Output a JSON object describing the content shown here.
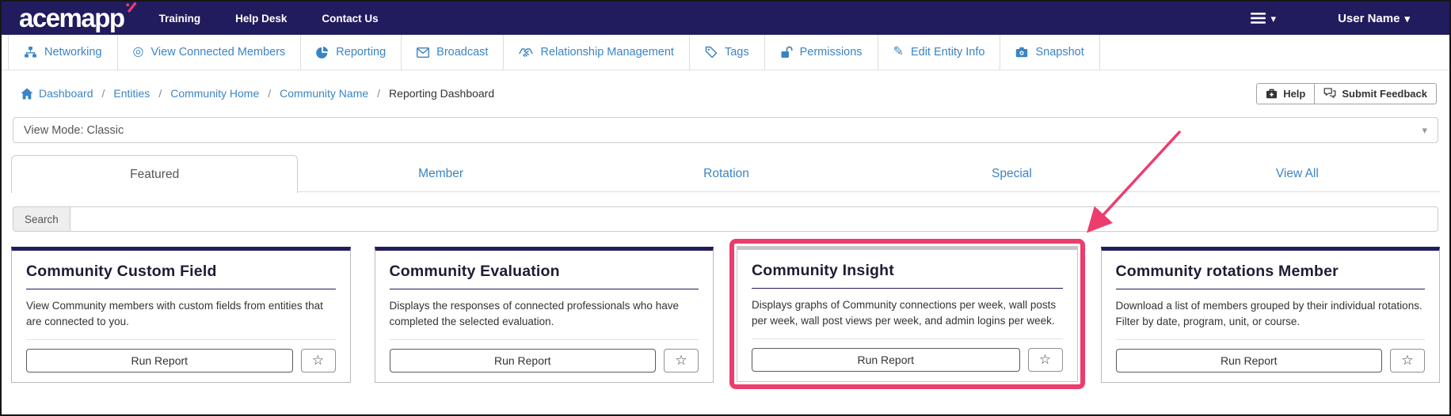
{
  "header": {
    "logo": "acemapp",
    "nav": [
      {
        "label": "Training"
      },
      {
        "label": "Help Desk"
      },
      {
        "label": "Contact Us"
      }
    ],
    "user_name": "User Name"
  },
  "toolbar": {
    "items": [
      {
        "label": "Networking",
        "icon": "sitemap"
      },
      {
        "label": "View Connected Members",
        "icon": "eye-target"
      },
      {
        "label": "Reporting",
        "icon": "pie-chart"
      },
      {
        "label": "Broadcast",
        "icon": "envelope"
      },
      {
        "label": "Relationship Management",
        "icon": "handshake"
      },
      {
        "label": "Tags",
        "icon": "tag"
      },
      {
        "label": "Permissions",
        "icon": "unlock"
      },
      {
        "label": "Edit Entity Info",
        "icon": "pencil"
      },
      {
        "label": "Snapshot",
        "icon": "camera"
      }
    ]
  },
  "breadcrumb": {
    "separator": "/",
    "items": [
      {
        "label": "Dashboard"
      },
      {
        "label": "Entities"
      },
      {
        "label": "Community Home"
      },
      {
        "label": "Community Name"
      },
      {
        "label": "Reporting Dashboard"
      }
    ]
  },
  "actions": {
    "help": "Help",
    "submit_feedback": "Submit Feedback"
  },
  "view_mode": {
    "value": "View Mode: Classic"
  },
  "tabs": [
    {
      "label": "Featured",
      "active": true
    },
    {
      "label": "Member",
      "active": false
    },
    {
      "label": "Rotation",
      "active": false
    },
    {
      "label": "Special",
      "active": false
    },
    {
      "label": "View All",
      "active": false
    }
  ],
  "search": {
    "label": "Search",
    "value": ""
  },
  "cards": [
    {
      "title": "Community Custom Field",
      "description": "View Community members with custom fields from entities that are connected to you.",
      "cta": "Run Report"
    },
    {
      "title": "Community Evaluation",
      "description": "Displays the responses of connected professionals who have completed the selected evaluation.",
      "cta": "Run Report"
    },
    {
      "title": "Community Insight",
      "description": "Displays graphs of Community connections per week, wall posts per week, wall post views per week, and admin logins per week.",
      "cta": "Run Report"
    },
    {
      "title": "Community rotations Member",
      "description": "Download a list of members grouped by their individual rotations. Filter by date, program, unit, or course.",
      "cta": "Run Report"
    }
  ],
  "annotation": {
    "type": "highlight-box-with-arrow",
    "highlighted_card": "Community Insight"
  },
  "colors": {
    "navy": "#211c5e",
    "pink": "#ec3d6d",
    "link_blue": "#3b84c4"
  },
  "icons": {
    "star_glyph": "☆",
    "caret_glyph": "▾",
    "pencil_glyph": "✎",
    "target_glyph": "◎"
  }
}
